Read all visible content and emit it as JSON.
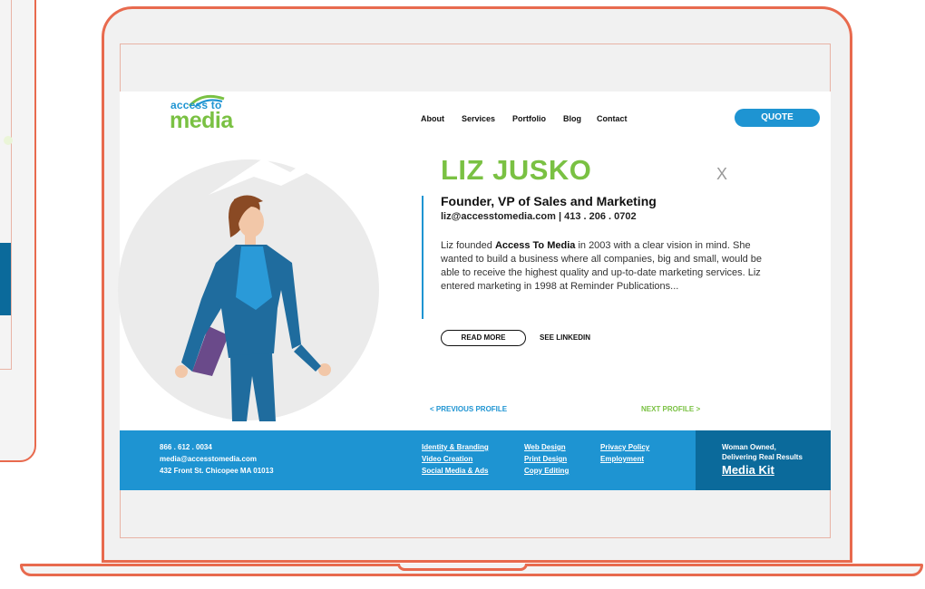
{
  "logo": {
    "small": "access to",
    "big": "media"
  },
  "nav": {
    "items": [
      "About",
      "Services",
      "Portfolio",
      "Blog",
      "Contact"
    ],
    "quote": "QUOTE"
  },
  "profile": {
    "name": "LIZ JUSKO",
    "close": "X",
    "title": "Founder, VP of Sales and Marketing",
    "contact": "liz@accesstomedia.com  |  413 . 206 . 0702",
    "bio_prefix": "Liz founded ",
    "bio_bold": "Access To Media",
    "bio_rest": " in 2003 with a clear vision in mind. She wanted to build a business where all companies, big and small, would be able to receive the highest quality and up-to-date marketing services. Liz entered marketing in 1998 at Reminder Publications...",
    "read_more": "READ MORE",
    "linkedin": "SEE LINKEDIN",
    "prev": "< PREVIOUS PROFILE",
    "next": "NEXT PROFILE >"
  },
  "footer": {
    "phone": "866 . 612 . 0034",
    "email": "media@accesstomedia.com",
    "address": "432 Front St. Chicopee MA 01013",
    "col1": [
      "Identity & Branding",
      "Video Creation",
      "Social Media & Ads"
    ],
    "col2": [
      "Web Design",
      "Print Design",
      "Copy Editing"
    ],
    "col3": [
      "Privacy Policy",
      "Employment"
    ],
    "tagline1": "Woman Owned,",
    "tagline2": "Delivering Real Results",
    "media_kit": "Media Kit"
  },
  "colors": {
    "brand_blue": "#1e94d2",
    "brand_green": "#7ac143",
    "footer_dark": "#0b6a9b",
    "frame": "#e86a4e"
  }
}
